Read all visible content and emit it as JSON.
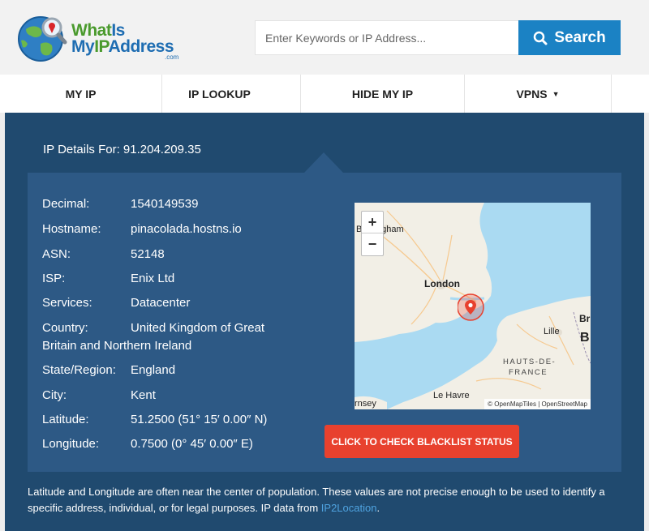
{
  "header": {
    "logo": {
      "line1_a": "What",
      "line1_b": "Is",
      "line2_a": "My",
      "line2_b": "IP",
      "line2_c": "Address",
      "suffix": ".com"
    },
    "search": {
      "placeholder": "Enter Keywords or IP Address...",
      "value": "",
      "button_label": "Search"
    }
  },
  "nav": {
    "items": [
      {
        "label": "MY IP"
      },
      {
        "label": "IP LOOKUP"
      },
      {
        "label": "HIDE MY IP"
      },
      {
        "label": "VPNS",
        "caret": "▼"
      }
    ]
  },
  "details": {
    "title": "IP Details For: 91.204.209.35",
    "rows": [
      {
        "label": "Decimal:",
        "value": "1540149539"
      },
      {
        "label": "Hostname:",
        "value": "pinacolada.hostns.io"
      },
      {
        "label": "ASN:",
        "value": "52148"
      },
      {
        "label": "ISP:",
        "value": "Enix Ltd"
      },
      {
        "label": "Services:",
        "value": "Datacenter"
      },
      {
        "label": "Country:",
        "value": "United Kingdom of Great",
        "value_continued": "Britain and Northern Ireland"
      },
      {
        "label": "State/Region:",
        "value": "England"
      },
      {
        "label": "City:",
        "value": "Kent"
      },
      {
        "label": "Latitude:",
        "value": "51.2500 (51° 15′ 0.00″ N)"
      },
      {
        "label": "Longitude:",
        "value": "0.7500 (0° 45′ 0.00″ E)"
      }
    ]
  },
  "map": {
    "zoom_in": "+",
    "zoom_out": "−",
    "labels": {
      "birmingham": "Birmingham",
      "london": "London",
      "lille": "Lille",
      "bruxelles": "Br",
      "brussels_b": "B",
      "hauts_line1": "HAUTS-DE-",
      "hauts_line2": "FRANCE",
      "le_havre": "Le Havre",
      "guernsey": "rnsey"
    },
    "attribution": "© OpenMapTiles | OpenStreetMap"
  },
  "blacklist_button": "CLICK TO CHECK BLACKLIST STATUS",
  "disclaimer": {
    "text": "Latitude and Longitude are often near the center of population. These values are not precise enough to be used to identify a specific address, individual, or for legal purposes. IP data from ",
    "link": "IP2Location",
    "end": "."
  },
  "colors": {
    "panel": "#204a6f",
    "inner": "#2d5985",
    "search_button": "#1b82c4",
    "blacklist_button": "#e8412e",
    "link": "#4fa3e0"
  }
}
